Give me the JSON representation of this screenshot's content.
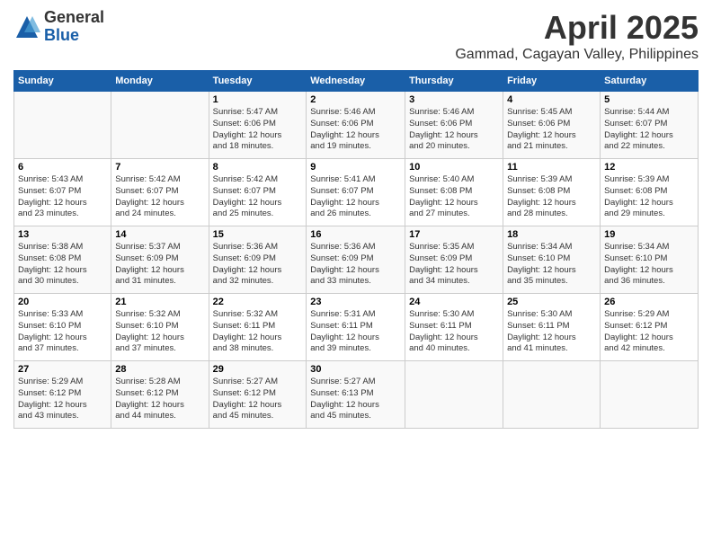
{
  "logo": {
    "general": "General",
    "blue": "Blue"
  },
  "title": "April 2025",
  "location": "Gammad, Cagayan Valley, Philippines",
  "days_of_week": [
    "Sunday",
    "Monday",
    "Tuesday",
    "Wednesday",
    "Thursday",
    "Friday",
    "Saturday"
  ],
  "weeks": [
    [
      {
        "day": "",
        "info": ""
      },
      {
        "day": "",
        "info": ""
      },
      {
        "day": "1",
        "info": "Sunrise: 5:47 AM\nSunset: 6:06 PM\nDaylight: 12 hours\nand 18 minutes."
      },
      {
        "day": "2",
        "info": "Sunrise: 5:46 AM\nSunset: 6:06 PM\nDaylight: 12 hours\nand 19 minutes."
      },
      {
        "day": "3",
        "info": "Sunrise: 5:46 AM\nSunset: 6:06 PM\nDaylight: 12 hours\nand 20 minutes."
      },
      {
        "day": "4",
        "info": "Sunrise: 5:45 AM\nSunset: 6:06 PM\nDaylight: 12 hours\nand 21 minutes."
      },
      {
        "day": "5",
        "info": "Sunrise: 5:44 AM\nSunset: 6:07 PM\nDaylight: 12 hours\nand 22 minutes."
      }
    ],
    [
      {
        "day": "6",
        "info": "Sunrise: 5:43 AM\nSunset: 6:07 PM\nDaylight: 12 hours\nand 23 minutes."
      },
      {
        "day": "7",
        "info": "Sunrise: 5:42 AM\nSunset: 6:07 PM\nDaylight: 12 hours\nand 24 minutes."
      },
      {
        "day": "8",
        "info": "Sunrise: 5:42 AM\nSunset: 6:07 PM\nDaylight: 12 hours\nand 25 minutes."
      },
      {
        "day": "9",
        "info": "Sunrise: 5:41 AM\nSunset: 6:07 PM\nDaylight: 12 hours\nand 26 minutes."
      },
      {
        "day": "10",
        "info": "Sunrise: 5:40 AM\nSunset: 6:08 PM\nDaylight: 12 hours\nand 27 minutes."
      },
      {
        "day": "11",
        "info": "Sunrise: 5:39 AM\nSunset: 6:08 PM\nDaylight: 12 hours\nand 28 minutes."
      },
      {
        "day": "12",
        "info": "Sunrise: 5:39 AM\nSunset: 6:08 PM\nDaylight: 12 hours\nand 29 minutes."
      }
    ],
    [
      {
        "day": "13",
        "info": "Sunrise: 5:38 AM\nSunset: 6:08 PM\nDaylight: 12 hours\nand 30 minutes."
      },
      {
        "day": "14",
        "info": "Sunrise: 5:37 AM\nSunset: 6:09 PM\nDaylight: 12 hours\nand 31 minutes."
      },
      {
        "day": "15",
        "info": "Sunrise: 5:36 AM\nSunset: 6:09 PM\nDaylight: 12 hours\nand 32 minutes."
      },
      {
        "day": "16",
        "info": "Sunrise: 5:36 AM\nSunset: 6:09 PM\nDaylight: 12 hours\nand 33 minutes."
      },
      {
        "day": "17",
        "info": "Sunrise: 5:35 AM\nSunset: 6:09 PM\nDaylight: 12 hours\nand 34 minutes."
      },
      {
        "day": "18",
        "info": "Sunrise: 5:34 AM\nSunset: 6:10 PM\nDaylight: 12 hours\nand 35 minutes."
      },
      {
        "day": "19",
        "info": "Sunrise: 5:34 AM\nSunset: 6:10 PM\nDaylight: 12 hours\nand 36 minutes."
      }
    ],
    [
      {
        "day": "20",
        "info": "Sunrise: 5:33 AM\nSunset: 6:10 PM\nDaylight: 12 hours\nand 37 minutes."
      },
      {
        "day": "21",
        "info": "Sunrise: 5:32 AM\nSunset: 6:10 PM\nDaylight: 12 hours\nand 37 minutes."
      },
      {
        "day": "22",
        "info": "Sunrise: 5:32 AM\nSunset: 6:11 PM\nDaylight: 12 hours\nand 38 minutes."
      },
      {
        "day": "23",
        "info": "Sunrise: 5:31 AM\nSunset: 6:11 PM\nDaylight: 12 hours\nand 39 minutes."
      },
      {
        "day": "24",
        "info": "Sunrise: 5:30 AM\nSunset: 6:11 PM\nDaylight: 12 hours\nand 40 minutes."
      },
      {
        "day": "25",
        "info": "Sunrise: 5:30 AM\nSunset: 6:11 PM\nDaylight: 12 hours\nand 41 minutes."
      },
      {
        "day": "26",
        "info": "Sunrise: 5:29 AM\nSunset: 6:12 PM\nDaylight: 12 hours\nand 42 minutes."
      }
    ],
    [
      {
        "day": "27",
        "info": "Sunrise: 5:29 AM\nSunset: 6:12 PM\nDaylight: 12 hours\nand 43 minutes."
      },
      {
        "day": "28",
        "info": "Sunrise: 5:28 AM\nSunset: 6:12 PM\nDaylight: 12 hours\nand 44 minutes."
      },
      {
        "day": "29",
        "info": "Sunrise: 5:27 AM\nSunset: 6:12 PM\nDaylight: 12 hours\nand 45 minutes."
      },
      {
        "day": "30",
        "info": "Sunrise: 5:27 AM\nSunset: 6:13 PM\nDaylight: 12 hours\nand 45 minutes."
      },
      {
        "day": "",
        "info": ""
      },
      {
        "day": "",
        "info": ""
      },
      {
        "day": "",
        "info": ""
      }
    ]
  ]
}
